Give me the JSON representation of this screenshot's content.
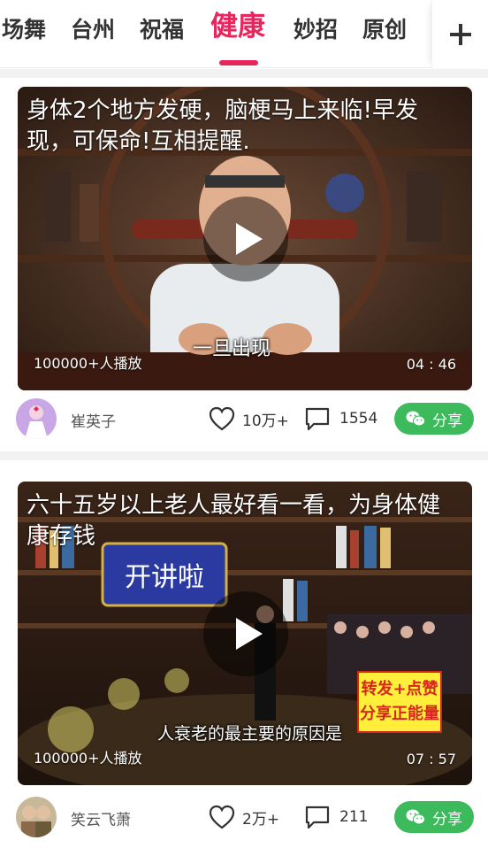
{
  "tabs": [
    {
      "label": "广场舞",
      "visible_label": "场舞"
    },
    {
      "label": "台州"
    },
    {
      "label": "祝福"
    },
    {
      "label": "健康",
      "active": true
    },
    {
      "label": "妙招"
    },
    {
      "label": "原创"
    }
  ],
  "accent_color": "#e8265e",
  "share_color": "#3cba5c",
  "icons": {
    "add": "plus-icon",
    "play": "play-icon",
    "like": "heart-icon",
    "comment": "comment-icon",
    "share": "wechat-icon"
  },
  "feed": [
    {
      "title": "身体2个地方发硬，脑梗马上来临!早发现，可保命!互相提醒.",
      "subtitle": "一旦出现",
      "plays": "100000+人播放",
      "duration": "04 : 46",
      "author": "崔英子",
      "likes": "10万+",
      "comments": "1554",
      "share_label": "分享"
    },
    {
      "title": "六十五岁以上老人最好看一看，为身体健康存钱",
      "subtitle": "人衰老的最主要的原因是",
      "badge_lines": [
        "转发+点赞",
        "分享正能量"
      ],
      "plays": "100000+人播放",
      "duration": "07 : 57",
      "author": "笑云飞萧",
      "likes": "2万+",
      "comments": "211",
      "share_label": "分享"
    }
  ]
}
